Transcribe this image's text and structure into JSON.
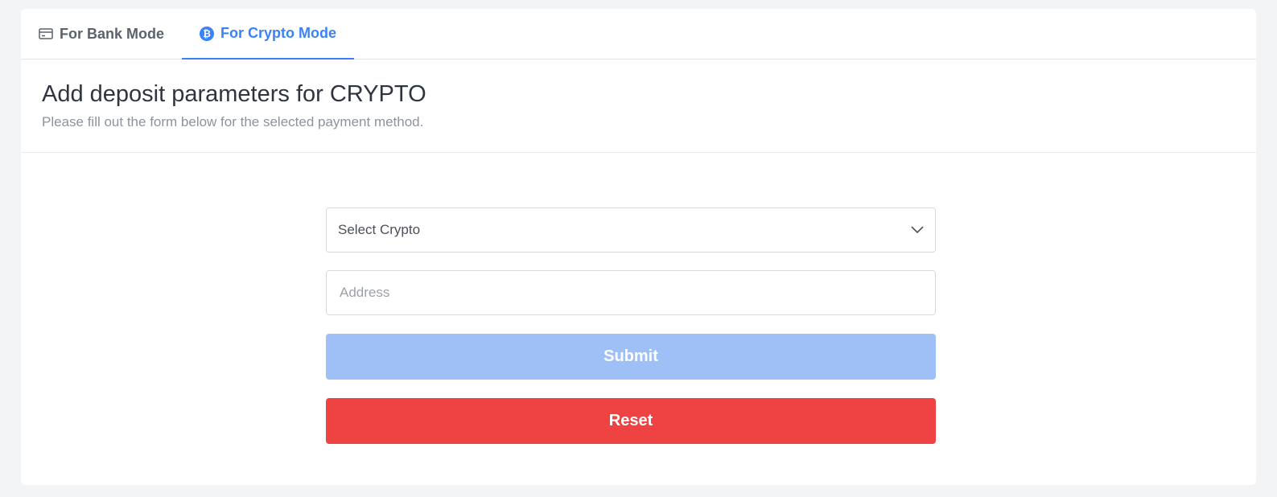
{
  "tabs": [
    {
      "label": "For Bank Mode",
      "icon": "credit-card-icon",
      "active": false
    },
    {
      "label": "For Crypto Mode",
      "icon": "bitcoin-icon",
      "active": true
    }
  ],
  "header": {
    "title": "Add deposit parameters for CRYPTO",
    "subtitle": "Please fill out the form below for the selected payment method."
  },
  "form": {
    "crypto_select": {
      "value": "Select Crypto",
      "icon": "chevron-down-icon"
    },
    "address": {
      "placeholder": "Address",
      "value": ""
    },
    "submit_label": "Submit",
    "reset_label": "Reset"
  },
  "colors": {
    "accent": "#3b82f6",
    "submit_disabled": "#9ec0f7",
    "reset": "#ef4343"
  }
}
